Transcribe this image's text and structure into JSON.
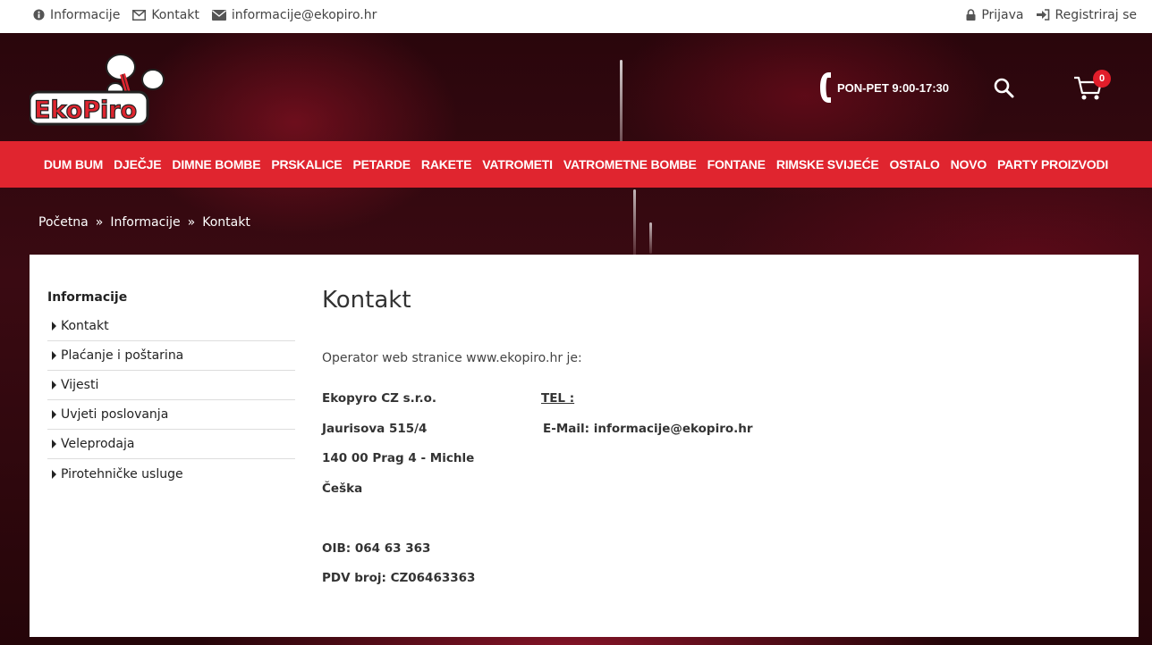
{
  "topbar": {
    "info_label": "Informacije",
    "contact_label": "Kontakt",
    "email_label": "informacije@ekopiro.hr",
    "login_label": "Prijava",
    "register_label": "Registriraj se"
  },
  "header": {
    "logo_text": "EkoPiro",
    "hours": "PON-PET 9:00-17:30",
    "cart_count": "0"
  },
  "nav": {
    "items": [
      "DUM BUM",
      "DJEČJE",
      "DIMNE BOMBE",
      "PRSKALICE",
      "PETARDE",
      "RAKETE",
      "VATROMETI",
      "VATROMETNE BOMBE",
      "FONTANE",
      "RIMSKE SVIJEĆE",
      "OSTALO",
      "NOVO",
      "PARTY PROIZVODI"
    ]
  },
  "breadcrumb": {
    "home": "Početna",
    "sep": "»",
    "section": "Informacije",
    "current": "Kontakt"
  },
  "sidebar": {
    "title": "Informacije",
    "items": [
      "Kontakt",
      "Plaćanje i poštarina",
      "Vijesti",
      "Uvjeti poslovanja",
      "Veleprodaja",
      "Pirotehničke usluge"
    ]
  },
  "main": {
    "title": "Kontakt",
    "intro": "Operator web stranice www.ekopiro.hr je:",
    "company": "Ekopyro CZ s.r.o.",
    "street": "Jaurisova 515/4",
    "city": "140 00  Prag 4 - Michle",
    "country": "Češka",
    "oib": "OIB: 064 63 363",
    "vat": "PDV broj: CZ06463363",
    "tel": "TEL :",
    "email": "E-Mail: informacije@ekopiro.hr"
  },
  "colors": {
    "accent": "#e0252f",
    "badge": "#e11d2a"
  }
}
